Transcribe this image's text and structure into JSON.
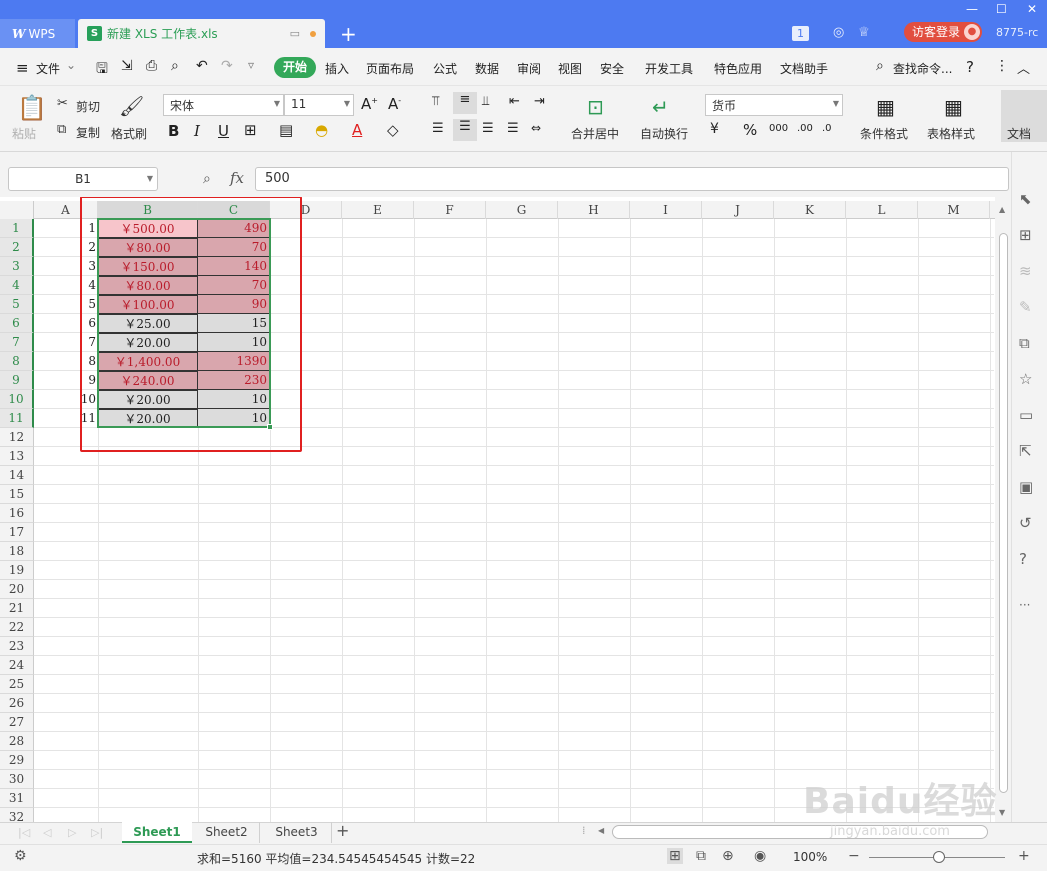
{
  "titlebar": {
    "wps_tab_label": "WPS",
    "doc_tab_label": "新建 XLS 工作表.xls",
    "doc_tab_icon": "S",
    "badge": "1",
    "login_label": "访客登录",
    "user_id": "8775-rc"
  },
  "menu": {
    "file": "文件",
    "start": "开始",
    "items": [
      "插入",
      "页面布局",
      "公式",
      "数据",
      "审阅",
      "视图",
      "安全",
      "开发工具",
      "特色应用",
      "文档助手"
    ],
    "search": "查找命令...",
    "help": "?"
  },
  "ribbon": {
    "paste": "粘贴",
    "cut": "剪切",
    "copy": "复制",
    "format_painter": "格式刷",
    "font_name": "宋体",
    "font_size": "11",
    "merge_center": "合并居中",
    "wrap_text": "自动换行",
    "number_format": "货币",
    "conditional_format": "条件格式",
    "table_style": "表格样式",
    "doc": "文档"
  },
  "formula_bar": {
    "name_box": "B1",
    "fx": "fx",
    "value": "500"
  },
  "columns": [
    "A",
    "B",
    "C",
    "D",
    "E",
    "F",
    "G",
    "H",
    "I",
    "J",
    "K",
    "L",
    "M"
  ],
  "rows": [
    "1",
    "2",
    "3",
    "4",
    "5",
    "6",
    "7",
    "8",
    "9",
    "10",
    "11",
    "12",
    "13",
    "14",
    "15",
    "16",
    "17",
    "18",
    "19",
    "20",
    "21",
    "22",
    "23",
    "24",
    "25",
    "26",
    "27",
    "28",
    "29",
    "30",
    "31",
    "32"
  ],
  "cells": {
    "A": [
      "1",
      "2",
      "3",
      "4",
      "5",
      "6",
      "7",
      "8",
      "9",
      "10",
      "11"
    ],
    "B": [
      "￥500.00",
      "￥80.00",
      "￥150.00",
      "￥80.00",
      "￥100.00",
      "￥25.00",
      "￥20.00",
      "￥1,400.00",
      "￥240.00",
      "￥20.00",
      "￥20.00"
    ],
    "C": [
      "490",
      "70",
      "140",
      "70",
      "90",
      "15",
      "10",
      "1390",
      "230",
      "10",
      "10"
    ]
  },
  "sheets": [
    "Sheet1",
    "Sheet2",
    "Sheet3"
  ],
  "status": {
    "summary": "求和=5160   平均值=234.54545454545   计数=22",
    "zoom": "100%"
  },
  "colors": {
    "title_bar": "#4d7af1",
    "accent_green": "#33a859",
    "highlight_red": "#d9a6ad",
    "highlight_text": "#b91c2b",
    "annotation_frame": "#e02020"
  },
  "watermark": {
    "brand": "Baidu经验",
    "url": "jingyan.baidu.com"
  }
}
